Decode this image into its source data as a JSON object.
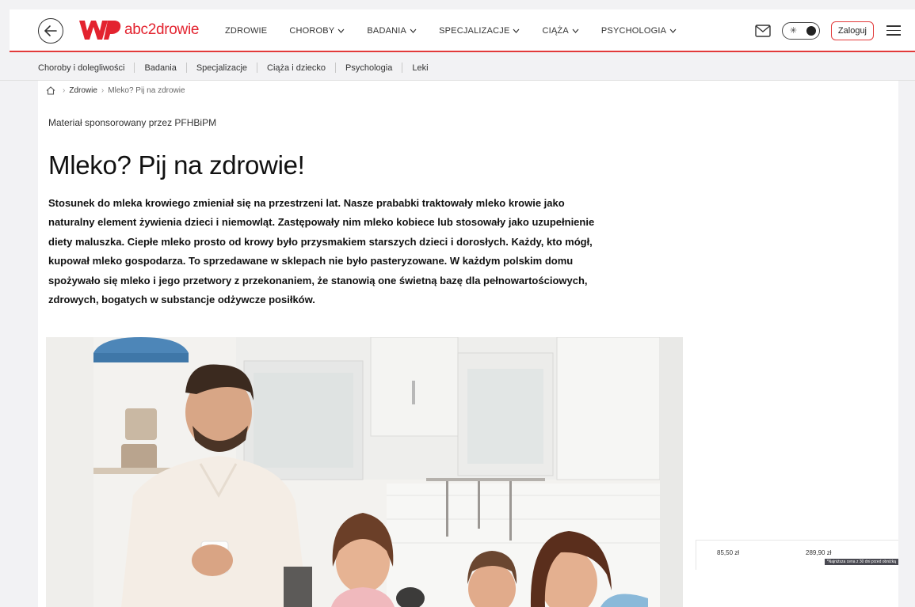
{
  "header": {
    "logo_text": "abc2drowie",
    "nav": [
      {
        "label": "ZDROWIE",
        "dropdown": false
      },
      {
        "label": "CHOROBY",
        "dropdown": true
      },
      {
        "label": "BADANIA",
        "dropdown": true
      },
      {
        "label": "SPECJALIZACJE",
        "dropdown": true
      },
      {
        "label": "CIĄŻA",
        "dropdown": true
      },
      {
        "label": "PSYCHOLOGIA",
        "dropdown": true
      }
    ],
    "login_label": "Zaloguj"
  },
  "subnav": [
    "Choroby i dolegliwości",
    "Badania",
    "Specjalizacje",
    "Ciąża i dziecko",
    "Psychologia",
    "Leki"
  ],
  "breadcrumb": {
    "items": [
      "Zdrowie",
      "Mleko? Pij na zdrowie"
    ]
  },
  "article": {
    "sponsored": "Materiał sponsorowany przez PFHBiPM",
    "title": "Mleko? Pij na zdrowie!",
    "lead": "Stosunek do mleka krowiego zmieniał się na przestrzeni lat. Nasze prababki traktowały mleko krowie jako naturalny element żywienia dzieci i niemowląt. Zastępowały nim mleko kobiece lub stosowały jako uzupełnienie diety maluszka. Ciepłe mleko prosto od krowy było przysmakiem starszych dzieci i dorosłych. Każdy, kto mógł, kupował mleko gospodarza. To sprzedawane w sklepach nie było pasteryzowane. W każdym polskim domu spożywało się mleko i jego przetwory z przekonaniem, że stanowią one świetną bazę dla pełnowartościowych, zdrowych, bogatych w substancje odżywcze posiłków."
  },
  "ad": {
    "price_1": "85,50 zł",
    "price_2": "289,90 zł",
    "note": "*Najniższa cena z 30 dni przed obniżką"
  },
  "colors": {
    "brand": "#e3232f",
    "accent_line": "#e23a3a"
  }
}
